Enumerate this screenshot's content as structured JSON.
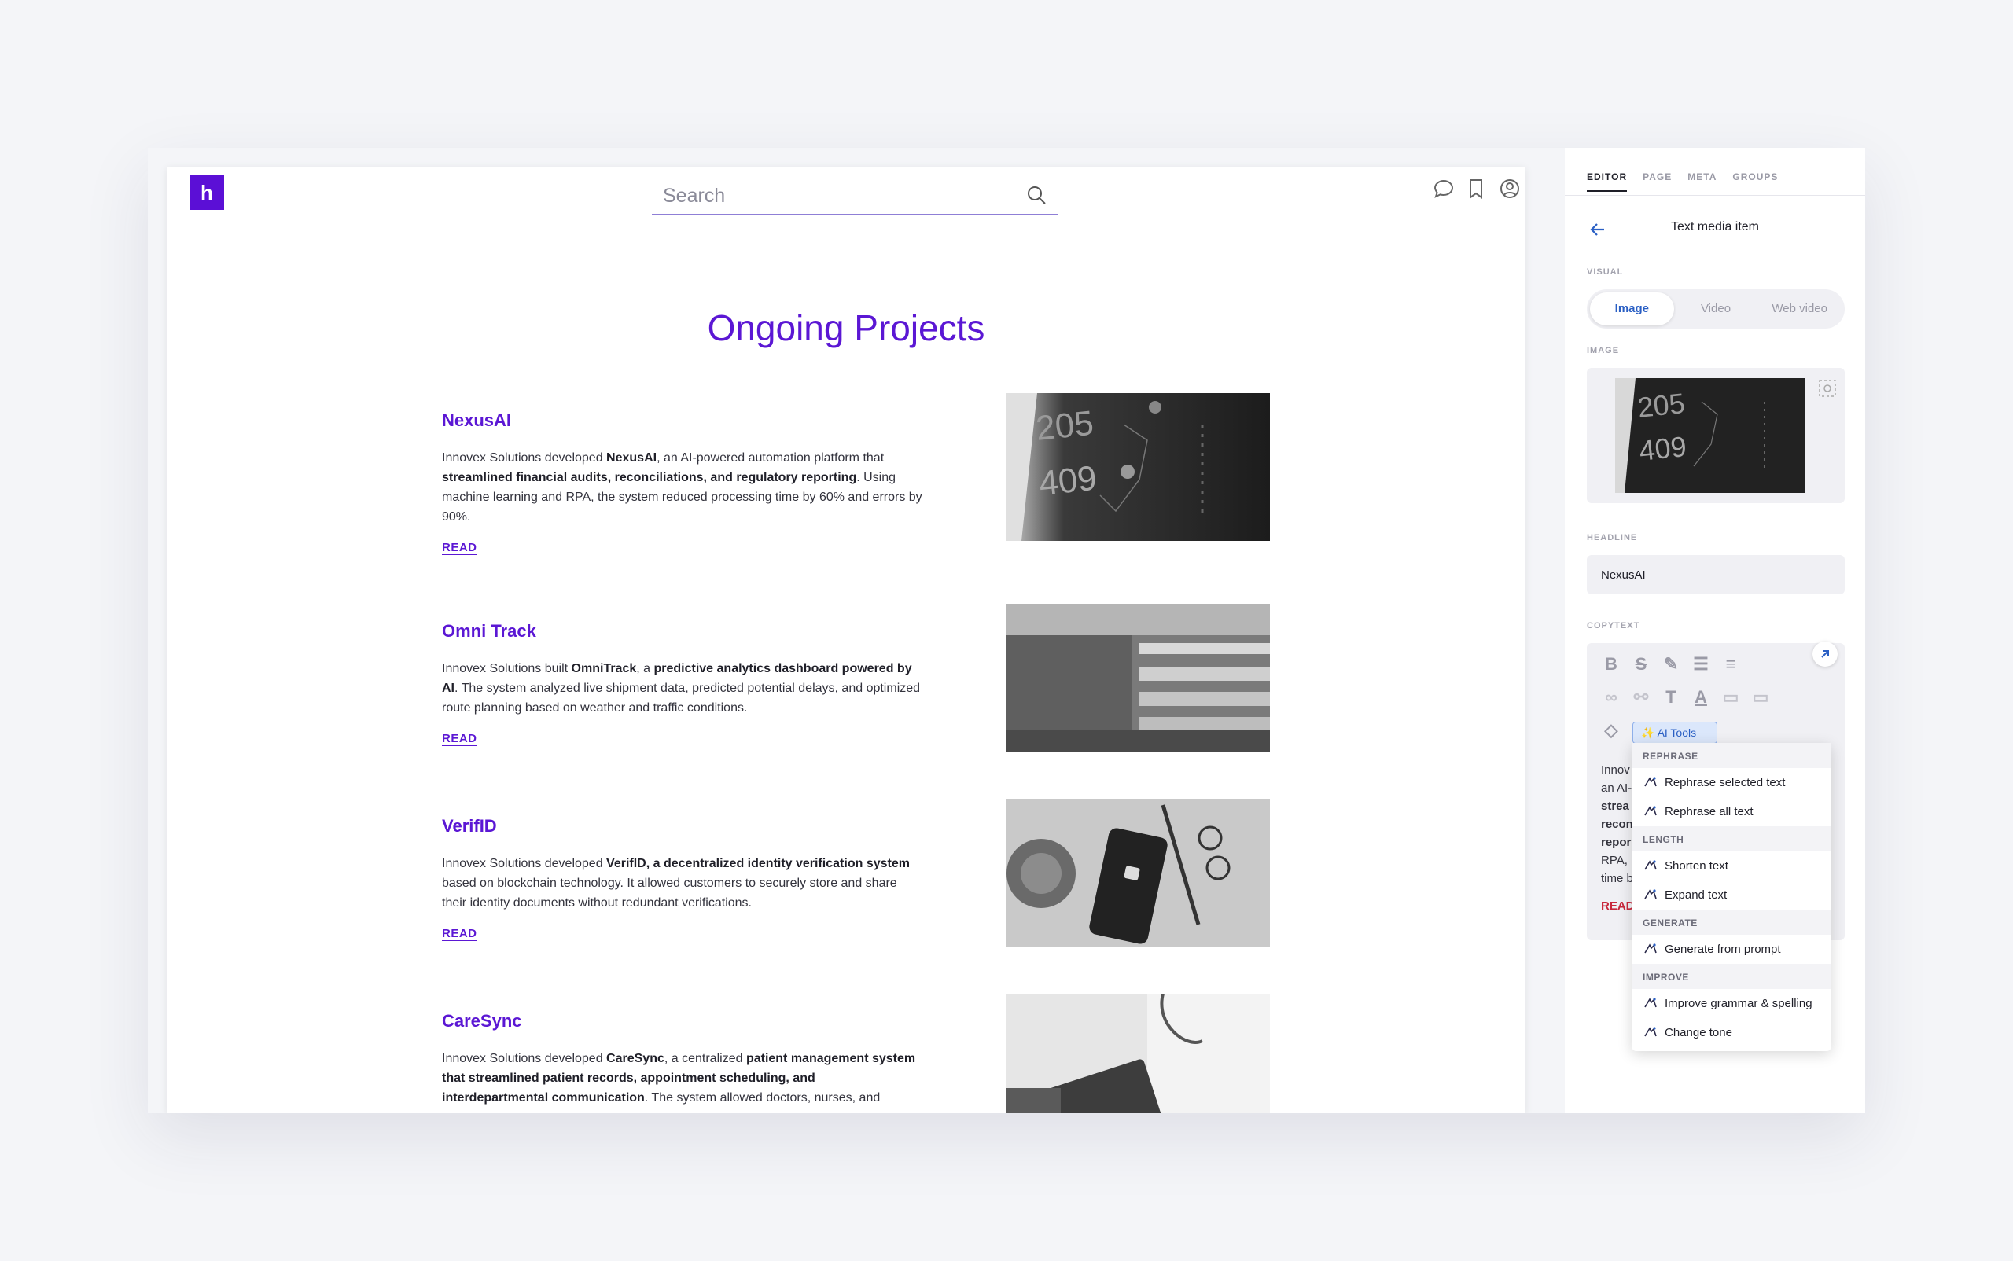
{
  "site": {
    "logo_letter": "h",
    "search_placeholder": "Search",
    "page_title": "Ongoing Projects",
    "read_label": "READ"
  },
  "projects": [
    {
      "title": "NexusAI",
      "text_parts": [
        {
          "t": "Innovex Solutions developed ",
          "b": false
        },
        {
          "t": "NexusAI",
          "b": true
        },
        {
          "t": ", an AI-powered automation platform that ",
          "b": false
        },
        {
          "t": "streamlined financial audits, reconciliations, and regulatory reporting",
          "b": true
        },
        {
          "t": ". Using machine learning and RPA, the system reduced processing time by 60% and errors by 90%.",
          "b": false
        }
      ]
    },
    {
      "title": "Omni Track",
      "text_parts": [
        {
          "t": "Innovex Solutions built ",
          "b": false
        },
        {
          "t": "OmniTrack",
          "b": true
        },
        {
          "t": ", a ",
          "b": false
        },
        {
          "t": "predictive analytics dashboard powered by AI",
          "b": true
        },
        {
          "t": ". The system analyzed live shipment data, predicted potential delays, and optimized route planning based on weather and traffic conditions.",
          "b": false
        }
      ]
    },
    {
      "title": "VerifID",
      "text_parts": [
        {
          "t": "Innovex Solutions developed ",
          "b": false
        },
        {
          "t": "VerifID, a decentralized identity verification system",
          "b": true
        },
        {
          "t": " based on blockchain technology. It allowed customers to securely store and share their identity documents without redundant verifications.",
          "b": false
        }
      ]
    },
    {
      "title": "CareSync",
      "text_parts": [
        {
          "t": "Innovex Solutions developed ",
          "b": false
        },
        {
          "t": "CareSync",
          "b": true
        },
        {
          "t": ", a centralized ",
          "b": false
        },
        {
          "t": "patient management system that streamlined patient records, appointment scheduling, and interdepartmental communication",
          "b": true
        },
        {
          "t": ". The system allowed doctors, nurses, and",
          "b": false
        }
      ]
    }
  ],
  "panel": {
    "tabs": [
      "EDITOR",
      "PAGE",
      "META",
      "GROUPS"
    ],
    "title": "Text media item",
    "visual_label": "VISUAL",
    "visual_options": [
      "Image",
      "Video",
      "Web video"
    ],
    "image_label": "IMAGE",
    "headline_label": "HEADLINE",
    "headline_value": "NexusAI",
    "copytext_label": "COPYTEXT",
    "ai_tools_label": "AI Tools",
    "body_lines": [
      "Innov",
      "an AI-",
      "strea",
      "recon",
      "repor",
      "RPA, t",
      "time b"
    ],
    "body_read": "READ"
  },
  "ai_menu": [
    {
      "section": "REPHRASE",
      "items": [
        {
          "label": "Rephrase selected text",
          "icon": "rephrase-selected-icon"
        },
        {
          "label": "Rephrase all text",
          "icon": "rephrase-all-icon"
        }
      ]
    },
    {
      "section": "LENGTH",
      "items": [
        {
          "label": "Shorten text",
          "icon": "shorten-icon"
        },
        {
          "label": "Expand text",
          "icon": "expand-text-icon"
        }
      ]
    },
    {
      "section": "GENERATE",
      "items": [
        {
          "label": "Generate from prompt",
          "icon": "generate-icon"
        }
      ]
    },
    {
      "section": "IMPROVE",
      "items": [
        {
          "label": "Improve grammar & spelling",
          "icon": "grammar-icon"
        },
        {
          "label": "Change tone",
          "icon": "tone-icon"
        }
      ]
    }
  ],
  "colors": {
    "accent": "#5b17d4",
    "link_blue": "#2a5fc4",
    "red": "#c8283c"
  }
}
